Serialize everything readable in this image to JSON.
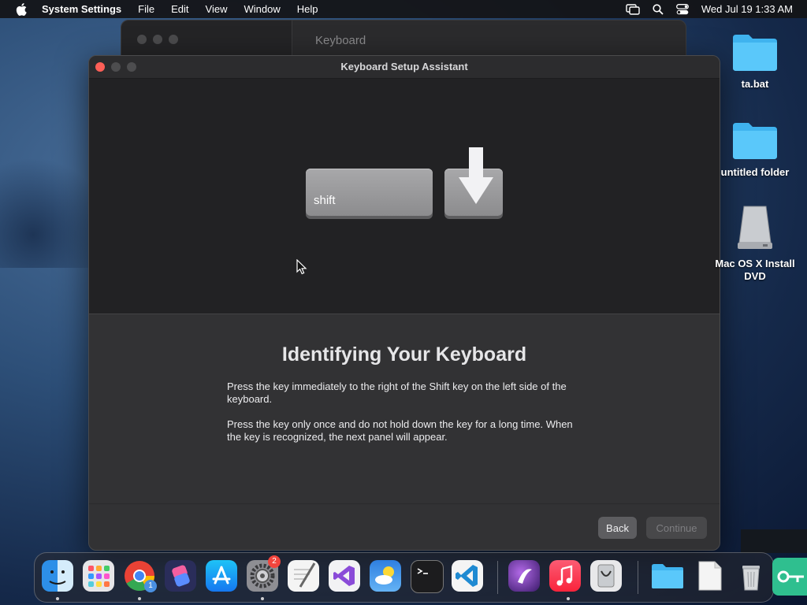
{
  "menubar": {
    "app_name": "System Settings",
    "menus": [
      "File",
      "Edit",
      "View",
      "Window",
      "Help"
    ],
    "clock": "Wed Jul 19  1:33 AM"
  },
  "background_window": {
    "title": "Keyboard"
  },
  "window": {
    "title": "Keyboard Setup Assistant",
    "shift_key_label": "shift",
    "heading": "Identifying Your Keyboard",
    "paragraph1": "Press the key immediately to the right of the Shift key on the left side of the keyboard.",
    "paragraph2": "Press the key only once and do not hold down the key for a long time. When the key is recognized, the next panel will appear.",
    "back_label": "Back",
    "continue_label": "Continue"
  },
  "desktop": {
    "items": [
      {
        "label": "ta.bat",
        "icon": "folder-icon"
      },
      {
        "label": "untitled folder",
        "icon": "folder-icon"
      },
      {
        "label": "Mac OS X Install DVD",
        "icon": "disk-icon"
      }
    ]
  },
  "dock": {
    "apps": [
      "Finder",
      "Launchpad",
      "Google Chrome",
      "Shortcuts",
      "App Store",
      "System Settings",
      "TextEdit",
      "Visual Studio",
      "Weather",
      "Terminal",
      "Visual Studio Code",
      "Nova",
      "Music",
      "Preview",
      "Downloads",
      "Document",
      "Trash"
    ],
    "chrome_badge": "1",
    "settings_badge": "2"
  },
  "colors": {
    "close": "#fe5f57",
    "accent_blue": "#5ac8fa",
    "badge_red": "#f2453d"
  }
}
